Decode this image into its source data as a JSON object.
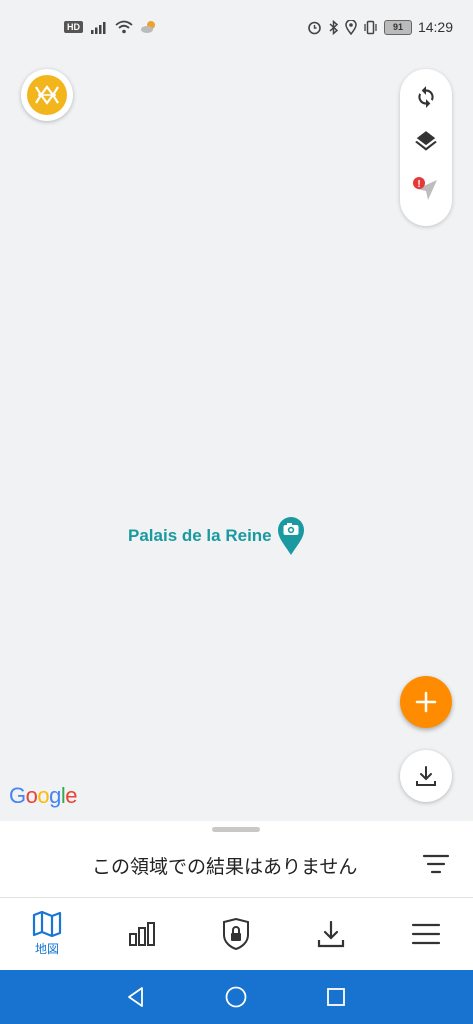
{
  "status_bar": {
    "hd_badge": "HD",
    "battery": "91",
    "time": "14:29"
  },
  "map": {
    "poi": {
      "label": "Palais de la Reine",
      "icon": "camera-pin-icon"
    },
    "google_logo": {
      "letters": [
        "G",
        "o",
        "o",
        "g",
        "l",
        "e"
      ],
      "colors": [
        "#4285F4",
        "#EA4335",
        "#FBBC05",
        "#4285F4",
        "#34A853",
        "#EA4335"
      ]
    },
    "controls": [
      "refresh-icon",
      "layers-icon",
      "location-arrow-icon"
    ],
    "alert_badge": "!"
  },
  "sheet": {
    "message": "この領域での結果はありません"
  },
  "bottom_nav": {
    "items": [
      {
        "icon": "map-icon",
        "label": "地図",
        "active": true
      },
      {
        "icon": "bar-chart-icon",
        "label": ""
      },
      {
        "icon": "shield-lock-icon",
        "label": ""
      },
      {
        "icon": "download-icon",
        "label": ""
      },
      {
        "icon": "menu-icon",
        "label": ""
      }
    ]
  },
  "colors": {
    "accent": "#1976d2",
    "fab": "#ff8c00",
    "poi": "#1a9aa0",
    "system_nav": "#1872cf",
    "profile": "#f2b51c"
  }
}
